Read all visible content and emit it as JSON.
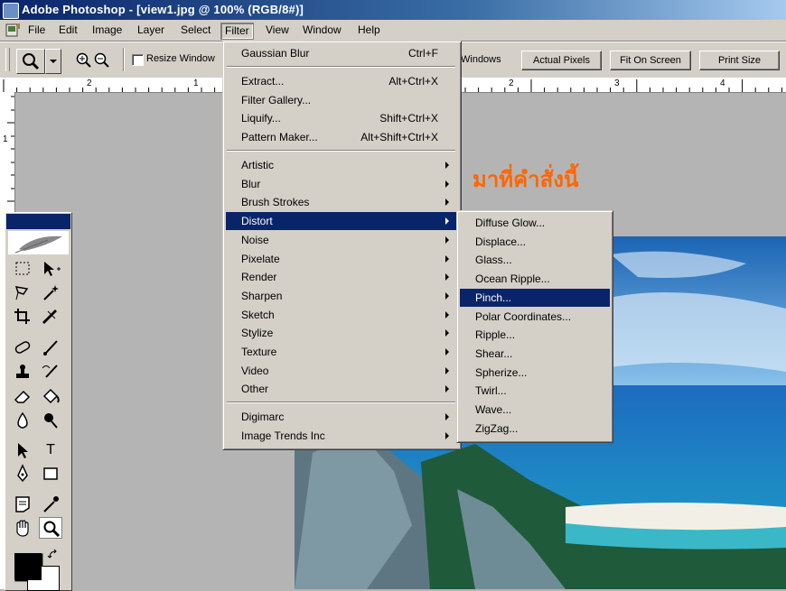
{
  "window": {
    "title": "Adobe Photoshop - [view1.jpg @ 100% (RGB/8#)]"
  },
  "menubar": [
    "File",
    "Edit",
    "Image",
    "Layer",
    "Select",
    "Filter",
    "View",
    "Window",
    "Help"
  ],
  "options_bar": {
    "resize_windows_label": "Resize Window",
    "windows_label": "Windows",
    "actual_pixels": "Actual Pixels",
    "fit_on_screen": "Fit On Screen",
    "print_size": "Print Size"
  },
  "ruler": {
    "h_labels": [
      "2",
      "1",
      "2",
      "3",
      "4"
    ],
    "v_labels": [
      "1"
    ]
  },
  "filter_menu": {
    "groups": [
      [
        {
          "label": "Gaussian Blur",
          "shortcut": "Ctrl+F"
        }
      ],
      [
        {
          "label": "Extract...",
          "shortcut": "Alt+Ctrl+X"
        },
        {
          "label": "Filter Gallery...",
          "shortcut": ""
        },
        {
          "label": "Liquify...",
          "shortcut": "Shift+Ctrl+X"
        },
        {
          "label": "Pattern Maker...",
          "shortcut": "Alt+Shift+Ctrl+X"
        }
      ],
      [
        {
          "label": "Artistic"
        },
        {
          "label": "Blur"
        },
        {
          "label": "Brush Strokes"
        },
        {
          "label": "Distort"
        },
        {
          "label": "Noise"
        },
        {
          "label": "Pixelate"
        },
        {
          "label": "Render"
        },
        {
          "label": "Sharpen"
        },
        {
          "label": "Sketch"
        },
        {
          "label": "Stylize"
        },
        {
          "label": "Texture"
        },
        {
          "label": "Video"
        },
        {
          "label": "Other"
        }
      ],
      [
        {
          "label": "Digimarc"
        },
        {
          "label": "Image Trends Inc"
        }
      ]
    ],
    "highlighted": "Distort"
  },
  "distort_submenu": {
    "items": [
      "Diffuse Glow...",
      "Displace...",
      "Glass...",
      "Ocean Ripple...",
      "Pinch...",
      "Polar Coordinates...",
      "Ripple...",
      "Shear...",
      "Spherize...",
      "Twirl...",
      "Wave...",
      "ZigZag..."
    ],
    "highlighted": "Pinch..."
  },
  "annotation": "มาที่คำสั่งนี้",
  "tools": [
    "T"
  ],
  "colors": {
    "title_active": "#0a246a",
    "menu_highlight": "#0a246a",
    "face": "#d4d0c8",
    "annotation": "#ff6600"
  }
}
